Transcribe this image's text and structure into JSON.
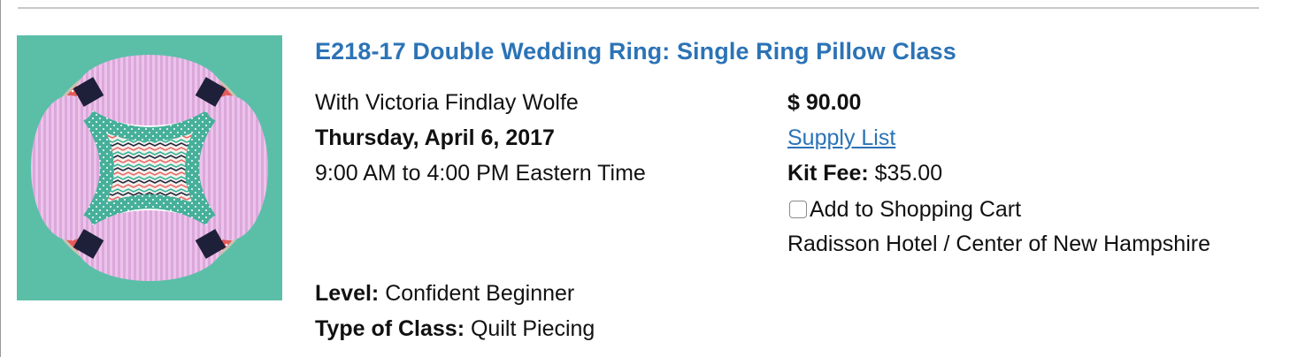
{
  "class_listing": {
    "title": "E218-17 Double Wedding Ring: Single Ring Pillow Class",
    "instructor": "With Victoria Findlay Wolfe",
    "date": "Thursday, April 6, 2017",
    "time": "9:00 AM to 4:00 PM Eastern Time",
    "price": "$ 90.00",
    "supply_list_link": "Supply List",
    "kit_fee_label": "Kit Fee:",
    "kit_fee_value": "$35.00",
    "add_to_cart_label": "Add to Shopping Cart",
    "add_to_cart_checked": false,
    "location": "Radisson Hotel / Center of New Hampshire",
    "level_label": "Level:",
    "level_value": "Confident Beginner",
    "type_label": "Type of Class:",
    "type_value": "Quilt Piecing",
    "image": {
      "description_icon": "quilt-photo",
      "colors": {
        "background": "#5bbfa8",
        "ring_red": "#e55b5b",
        "arc_teal": "#46b09a",
        "center_pink": "#e9bfe6",
        "corner_navy": "#1d2038",
        "link_blue": "#2b73b6"
      }
    }
  }
}
